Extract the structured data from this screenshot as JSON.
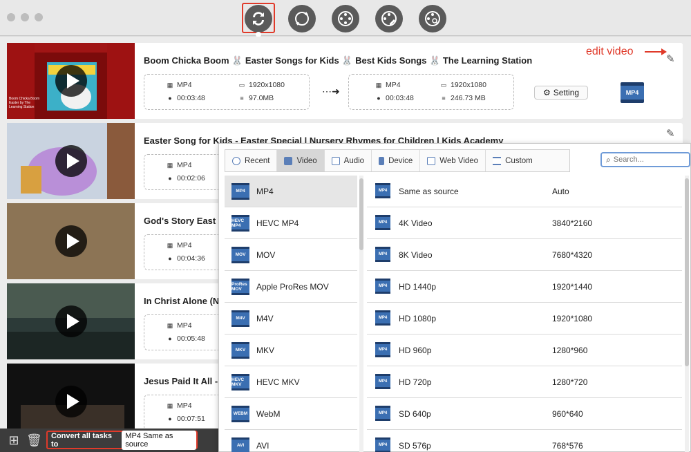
{
  "app": {
    "toolbar_tools": [
      "convert-icon",
      "rotate-icon",
      "film-icon",
      "film-edit-icon",
      "film-search-icon"
    ]
  },
  "annotation": {
    "edit_note": "edit video"
  },
  "videos": [
    {
      "title": "Boom Chicka Boom 🐰 Easter Songs for Kids 🐰 Best Kids Songs 🐰 The Learning Station",
      "thumb_text": "Boom Chicka Boom Easter by The Learning Station",
      "src_format": "MP4",
      "src_duration": "00:03:48",
      "src_resolution": "1920x1080",
      "src_size": "97.0MB",
      "out_format": "MP4",
      "out_duration": "00:03:48",
      "out_resolution": "1920x1080",
      "out_size": "246.73 MB",
      "setting_label": "Setting",
      "badge": "MP4"
    },
    {
      "title": "Easter Song for Kids - Easter Special | Nursery Rhymes for Children | Kids Academy",
      "src_format": "MP4",
      "src_duration": "00:02:06"
    },
    {
      "title": "God's Story  East",
      "src_format": "MP4",
      "src_duration": "00:04:36"
    },
    {
      "title": "In Christ Alone (N",
      "src_format": "MP4",
      "src_duration": "00:05:48"
    },
    {
      "title": "Jesus Paid It All -",
      "src_format": "MP4",
      "src_duration": "00:07:51"
    }
  ],
  "bottom": {
    "convert_label": "Convert all tasks to",
    "convert_value": "MP4 Same as source"
  },
  "panel": {
    "tabs": [
      "Recent",
      "Video",
      "Audio",
      "Device",
      "Web Video",
      "Custom"
    ],
    "active_tab": "Video",
    "search_placeholder": "Search...",
    "formats": [
      {
        "name": "MP4",
        "icon": "MP4"
      },
      {
        "name": "HEVC MP4",
        "icon": "HEVC MP4"
      },
      {
        "name": "MOV",
        "icon": "MOV"
      },
      {
        "name": "Apple ProRes MOV",
        "icon": "ProRes MOV"
      },
      {
        "name": "M4V",
        "icon": "M4V"
      },
      {
        "name": "MKV",
        "icon": "MKV"
      },
      {
        "name": "HEVC MKV",
        "icon": "HEVC MKV"
      },
      {
        "name": "WebM",
        "icon": "WEBM"
      },
      {
        "name": "AVI",
        "icon": "AVI"
      }
    ],
    "resolutions": [
      {
        "name": "Same as source",
        "value": "Auto"
      },
      {
        "name": "4K Video",
        "value": "3840*2160"
      },
      {
        "name": "8K Video",
        "value": "7680*4320"
      },
      {
        "name": "HD 1440p",
        "value": "1920*1440"
      },
      {
        "name": "HD 1080p",
        "value": "1920*1080"
      },
      {
        "name": "HD 960p",
        "value": "1280*960"
      },
      {
        "name": "HD 720p",
        "value": "1280*720"
      },
      {
        "name": "SD 640p",
        "value": "960*640"
      },
      {
        "name": "SD 576p",
        "value": "768*576"
      }
    ]
  },
  "colors": {
    "accent_red": "#e03a2a",
    "format_blue": "#3b6fb2",
    "bottom_bar": "#3c3c3c"
  }
}
